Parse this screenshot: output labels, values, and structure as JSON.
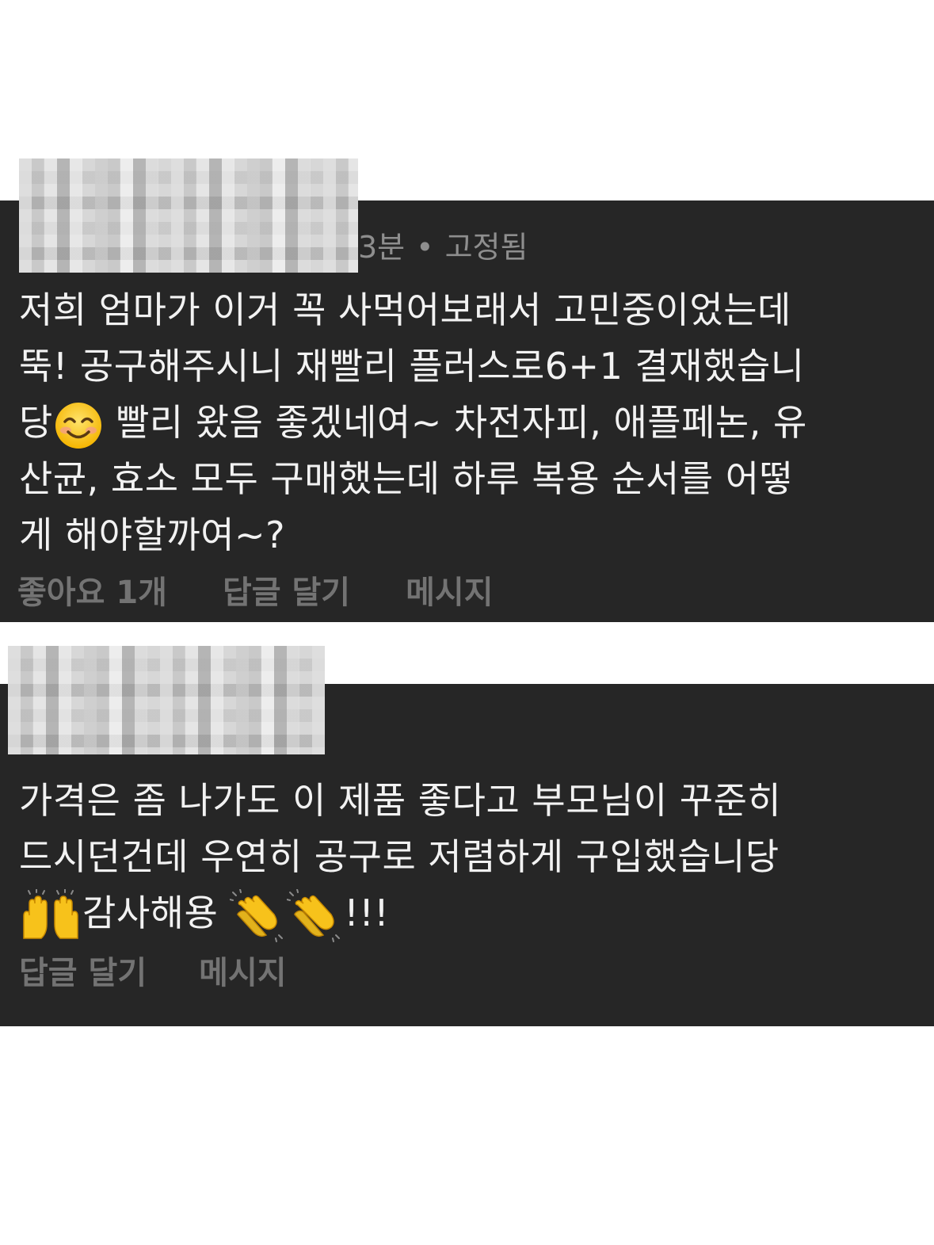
{
  "comments": [
    {
      "time_partial": "3분",
      "separator": "•",
      "pinned_label": "고정됨",
      "text_before_emoji": "저희 엄마가 이거 꼭 사먹어보래서 고민중이었는데\n뚝! 공구해주시니 재빨리 플러스로6+1 결재했습니\n당",
      "emoji_1": "smiling-face-icon",
      "text_after_emoji": " 빨리 왔음 좋겠네여~ 차전자피, 애플페논, 유\n산균, 효소 모두 구매했는데 하루 복용 순서를 어떻\n게 해야할까여~?",
      "likes_label": "좋아요 1개",
      "reply_label": "답글 달기",
      "message_label": "메시지"
    },
    {
      "text_main": "가격은 좀 나가도 이 제품 좋다고 부모님이 꾸준히\n드시던건데 우연히 공구로 저렴하게 구입했습니당\n",
      "emoji_1": "raising-hands-icon",
      "text_mid": "감사해용 ",
      "emoji_2": "clapping-hands-icon",
      "emoji_3": "clapping-hands-icon",
      "text_end": "!!!",
      "reply_label": "답글 달기",
      "message_label": "메시지"
    }
  ],
  "colors": {
    "panel_bg": "#262626",
    "text": "#f2f2f2",
    "meta": "#8e8e8e",
    "actions": "#737373"
  }
}
